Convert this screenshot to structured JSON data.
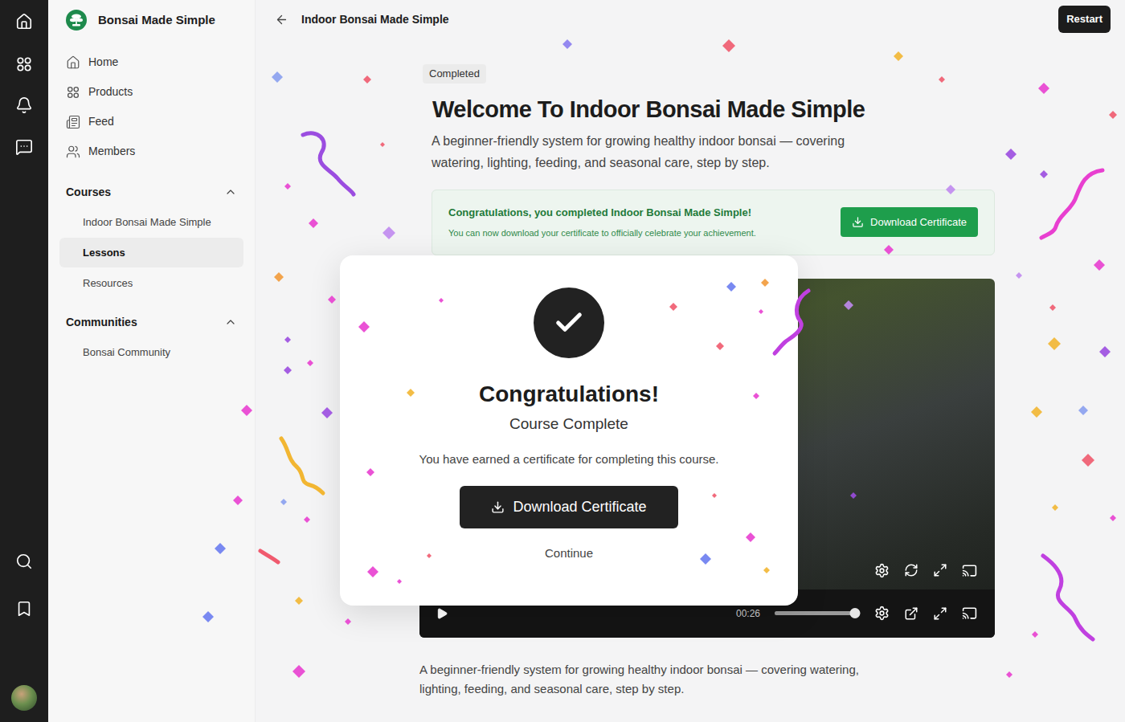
{
  "app": {
    "name": "Bonsai Made Simple"
  },
  "sidebar": {
    "items": [
      {
        "label": "Home"
      },
      {
        "label": "Products"
      },
      {
        "label": "Feed"
      },
      {
        "label": "Members"
      }
    ],
    "sections": [
      {
        "title": "Courses",
        "expanded": true,
        "items": [
          {
            "label": "Indoor Bonsai Made Simple",
            "selected": false
          },
          {
            "label": "Lessons",
            "selected": true
          },
          {
            "label": "Resources",
            "selected": false
          }
        ]
      },
      {
        "title": "Communities",
        "expanded": true,
        "items": [
          {
            "label": "Bonsai Community",
            "selected": false
          }
        ]
      }
    ]
  },
  "header": {
    "title": "Indoor Bonsai Made Simple",
    "button": "Restart"
  },
  "course": {
    "badge": "Completed",
    "title": "Welcome To Indoor Bonsai Made Simple",
    "description": "A beginner-friendly system for growing healthy indoor bonsai — covering watering, lighting, feeding, and seasonal care, step by step."
  },
  "banner": {
    "title": "Congratulations, you completed Indoor Bonsai Made Simple!",
    "text": "You can now download your certificate to officially celebrate your achievement.",
    "button": "Download Certificate"
  },
  "video": {
    "time": "00:26",
    "volume": {
      "level": 1
    }
  },
  "footer": {
    "text": "A beginner-friendly system for growing healthy indoor bonsai — covering watering, lighting, feeding, and seasonal care, step by step."
  },
  "modal": {
    "title": "Congratulations!",
    "subtitle": "Course Complete",
    "text": "You have earned a certificate for completing this course.",
    "button": "Download Certificate",
    "link": "Continue"
  }
}
